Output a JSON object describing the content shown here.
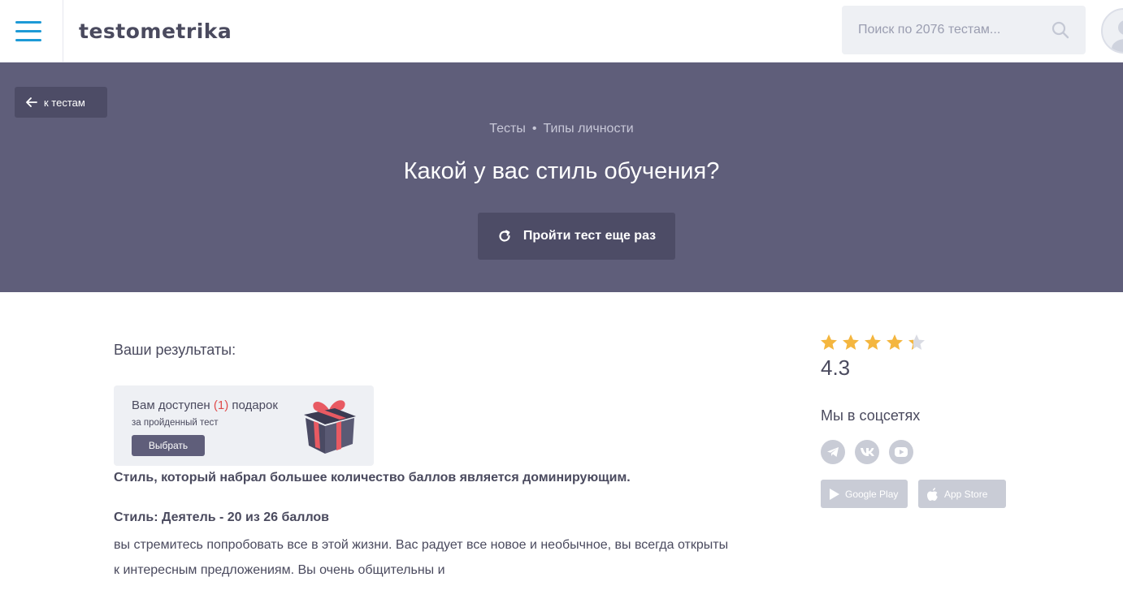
{
  "header": {
    "logo": "testometrika",
    "search_placeholder": "Поиск по 2076 тестам..."
  },
  "hero": {
    "back_label": "к тестам",
    "breadcrumbs": [
      "Тесты",
      "Типы личности"
    ],
    "title": "Какой у вас стиль обучения?",
    "retry_label": "Пройти тест еще раз"
  },
  "results": {
    "title": "Ваши результаты:",
    "gift": {
      "prefix": "Вам доступен",
      "count": "(1)",
      "suffix": "подарок",
      "subtitle": "за пройденный тест",
      "button": "Выбрать"
    },
    "dominant_note": "Стиль, который набрал большее количество баллов является доминирующим.",
    "style_title": "Стиль: Деятель - 20 из 26 баллов",
    "style_description": "вы стремитесь попробовать все в этой жизни. Вас радует все новое и необычное, вы всегда открыты к интересным предложениям. Вы очень общительны и"
  },
  "sidebar": {
    "rating_value": 4.3,
    "rating_label": "4.3",
    "social_title": "Мы в соцсетях",
    "social_icons": [
      "telegram-icon",
      "vk-icon",
      "youtube-icon"
    ],
    "stores": {
      "google": "Google Play",
      "apple": "App Store"
    }
  },
  "colors": {
    "accent": "#1d9ad6",
    "hero_bg": "#5f5e7a",
    "button_dark": "#4d4c66",
    "star": "#f4b63f",
    "gift_count": "#e04b4b"
  }
}
